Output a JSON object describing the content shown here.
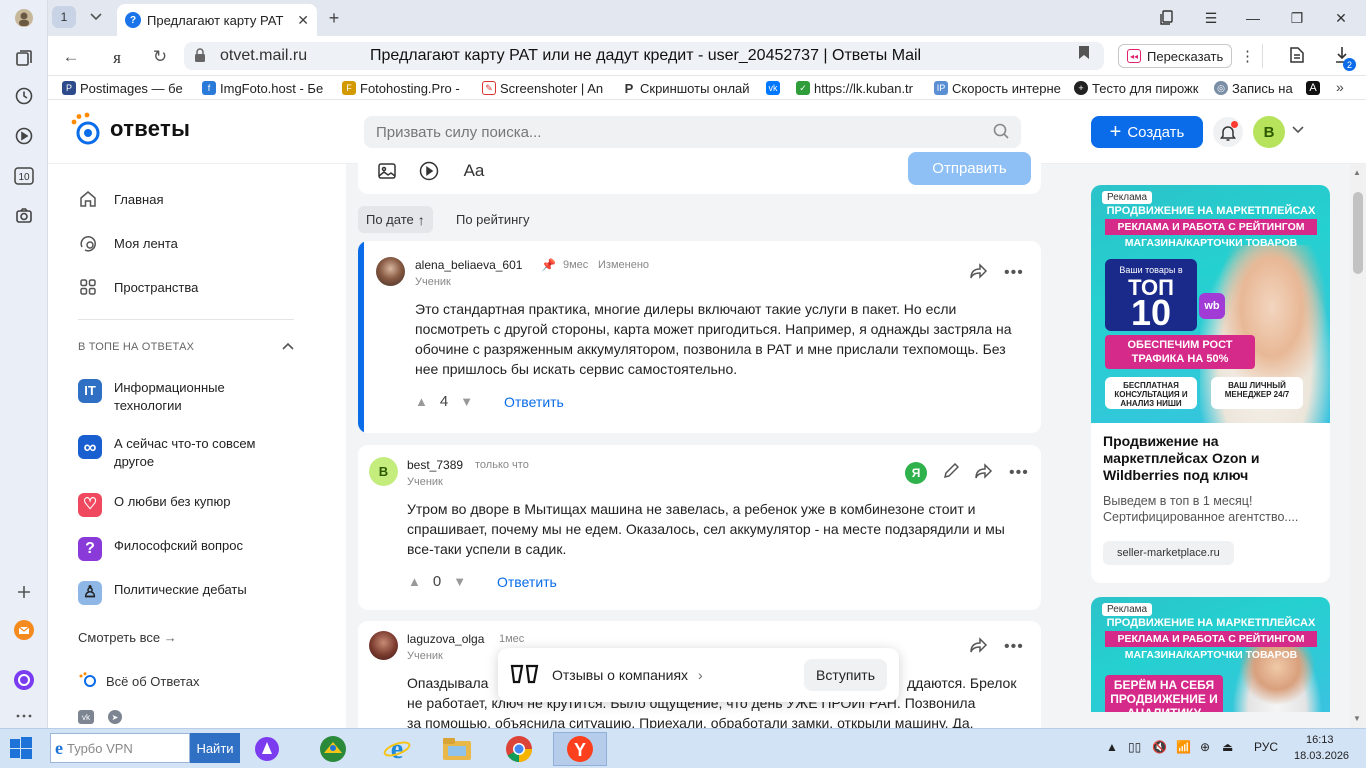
{
  "browser": {
    "tab_count": "1",
    "tab_title": "Предлагают карту РАТ",
    "domain": "otvet.mail.ru",
    "page_title": "Предлагают карту РАТ или не дадут кредит - user_20452737 | Ответы Mail",
    "retell_label": "Пересказать",
    "downloads_badge": "2",
    "bookmarks": [
      {
        "label": "Postimages — бе",
        "icon": "postimages-icon",
        "color": "#2d4a8a"
      },
      {
        "label": "ImgFoto.host - Бе",
        "icon": "imgfoto-icon",
        "color": "#2a7bd9"
      },
      {
        "label": "Fotohosting.Pro -",
        "icon": "fotohosting-icon",
        "color": "#d39a00"
      },
      {
        "label": "Screenshoter | An",
        "icon": "screenshoter-icon",
        "color": "#d33"
      },
      {
        "label": "Скриншоты онлай",
        "icon": "p-icon",
        "color": "#333"
      },
      {
        "label": "",
        "icon": "vk-icon",
        "color": "#0077ff"
      },
      {
        "label": "https://lk.kuban.tr",
        "icon": "kuban-icon",
        "color": "#2e9d3a"
      },
      {
        "label": "Скорость интерне",
        "icon": "speedtest-icon",
        "color": "#5b8fd4"
      },
      {
        "label": "Тесто для пирожк",
        "icon": "recipe-icon",
        "color": "#222"
      },
      {
        "label": "Запись на",
        "icon": "gosuslugi-icon",
        "color": "#7a8ea6"
      }
    ]
  },
  "header": {
    "logo_text": "ответы",
    "search_placeholder": "Призвать силу поиска...",
    "create_label": "Создать",
    "avatar_letter": "В"
  },
  "sidebar": {
    "nav": [
      {
        "label": "Главная",
        "icon": "home-icon"
      },
      {
        "label": "Моя лента",
        "icon": "feed-icon"
      },
      {
        "label": "Пространства",
        "icon": "spaces-icon"
      }
    ],
    "section_title": "В ТОПЕ НА ОТВЕТАХ",
    "topics": [
      {
        "label": "Информационные технологии",
        "icon": "it-icon",
        "color": "#2f6fc4",
        "glyph": "IT"
      },
      {
        "label": "А сейчас что-то совсем другое",
        "icon": "infinity-icon",
        "color": "#1a5fd0",
        "glyph": "∞"
      },
      {
        "label": "О любви без купюр",
        "icon": "heart-icon",
        "color": "#f0485e",
        "glyph": "♡"
      },
      {
        "label": "Философский вопрос",
        "icon": "question-icon",
        "color": "#8a3ad8",
        "glyph": "?"
      },
      {
        "label": "Политические дебаты",
        "icon": "podium-icon",
        "color": "#8fb7e6",
        "glyph": "♙"
      }
    ],
    "see_all": "Смотреть все",
    "about": "Всё об Ответах"
  },
  "editor": {
    "font_button": "Aa",
    "send_label": "Отправить"
  },
  "sort": {
    "by_date": "По дате",
    "by_rating": "По рейтингу"
  },
  "answers": [
    {
      "username": "alena_beliaeva_601",
      "time": "9мес",
      "edited": "Изменено",
      "status": "Ученик",
      "text": "Это стандартная практика, многие дилеры включают такие услуги в пакет. Но если посмотреть с другой стороны, карта может пригодиться. Например, я однажды застряла на обочине с разряженным аккумулятором, позвонила в РАТ и мне прислали техпомощь. Без нее пришлось бы искать сервис самостоятельно.",
      "votes": "4",
      "reply": "Ответить"
    },
    {
      "username": "best_7389",
      "time": "только что",
      "status": "Ученик",
      "avatar_letter": "B",
      "text": "Утром во дворе в Мытищах машина не завелась, а ребенок уже в комбинезоне стоит и спрашивает, почему мы не едем. Оказалось, сел аккумулятор - на месте подзарядили и мы все-таки успели в садик.",
      "votes": "0",
      "reply": "Ответить"
    },
    {
      "username": "laguzova_olga",
      "time": "1мес",
      "status": "Ученик",
      "text_line1_left": "Опаздывала",
      "text_line1_right": "ддаются. Брелок",
      "text_line2": "не работает, ключ не крутится. Было ощущение, что день УЖЕ ПРОИГРАН. Позвонила",
      "text_line3": "за помощью, объяснила ситуацию. Приехали, обработали замки, открыли машину. Да,"
    }
  ],
  "toast": {
    "label": "Отзывы о компаниях",
    "button": "Вступить"
  },
  "ads": [
    {
      "tag": "Реклама",
      "line1": "ПРОДВИЖЕНИЕ НА МАРКЕТПЛЕЙСАХ",
      "line2": "РЕКЛАМА И РАБОТА С РЕЙТИНГОМ",
      "line3": "МАГАЗИНА/КАРТОЧКИ ТОВАРОВ",
      "box_top": "Ваши товары в",
      "box_mid": "ТОП",
      "box_num": "10",
      "pink": "ОБЕСПЕЧИМ РОСТ ТРАФИКА НА 50%",
      "gift1": "БЕСПЛАТНАЯ КОНСУЛЬТАЦИЯ И АНАЛИЗ НИШИ",
      "gift2": "ВАШ ЛИЧНЫЙ МЕНЕДЖЕР 24/7",
      "title": "Продвижение на маркетплейсах Ozon и Wildberries под ключ",
      "text": "Выведем в топ в 1 месяц! Сертифицированное агентство....",
      "link": "seller-marketplace.ru"
    },
    {
      "tag": "Реклама",
      "line1": "ПРОДВИЖЕНИЕ НА МАРКЕТПЛЕЙСАХ",
      "line2": "РЕКЛАМА И РАБОТА С РЕЙТИНГОМ",
      "line3": "МАГАЗИНА/КАРТОЧКИ ТОВАРОВ",
      "pink": "БЕРЁМ НА СЕБЯ ПРОДВИЖЕНИЕ И АНАЛИТИКУ"
    }
  ],
  "taskbar": {
    "search_text": "Турбо VPN",
    "find_label": "Найти",
    "lang": "РУС",
    "time": "16:13",
    "date": "18.03.2026"
  }
}
